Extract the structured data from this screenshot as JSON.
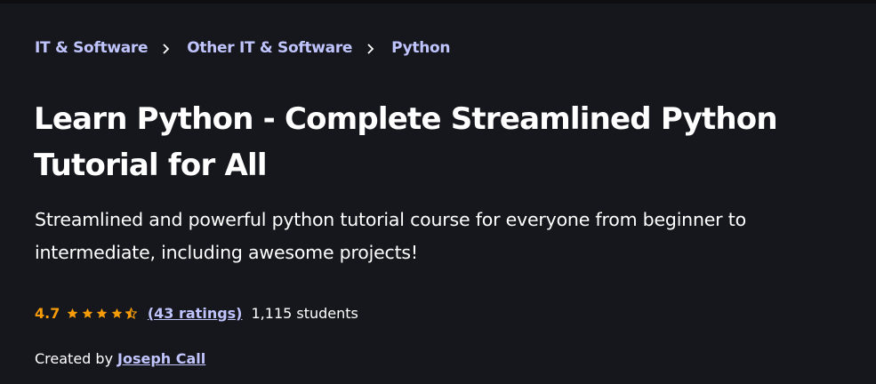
{
  "breadcrumb": {
    "items": [
      {
        "label": "IT & Software"
      },
      {
        "label": "Other IT & Software"
      },
      {
        "label": "Python"
      }
    ]
  },
  "course": {
    "title": "Learn Python - Complete Streamlined Python Tutorial for All",
    "subtitle": "Streamlined and powerful python tutorial course for everyone from beginner to intermediate, including awesome projects!"
  },
  "rating": {
    "value": "4.7",
    "stars": 4.5,
    "ratings_text": "(43 ratings)",
    "students_text": "1,115 students"
  },
  "creator": {
    "label": "Created by",
    "name": "Joseph Call"
  },
  "colors": {
    "background": "#16161d",
    "link": "#c0c4fc",
    "rating_orange": "#f69c08",
    "text": "#ffffff"
  },
  "icons": {
    "breadcrumb_separator": "chevron-right-icon",
    "star_full": "star-icon",
    "star_half": "star-half-icon"
  }
}
